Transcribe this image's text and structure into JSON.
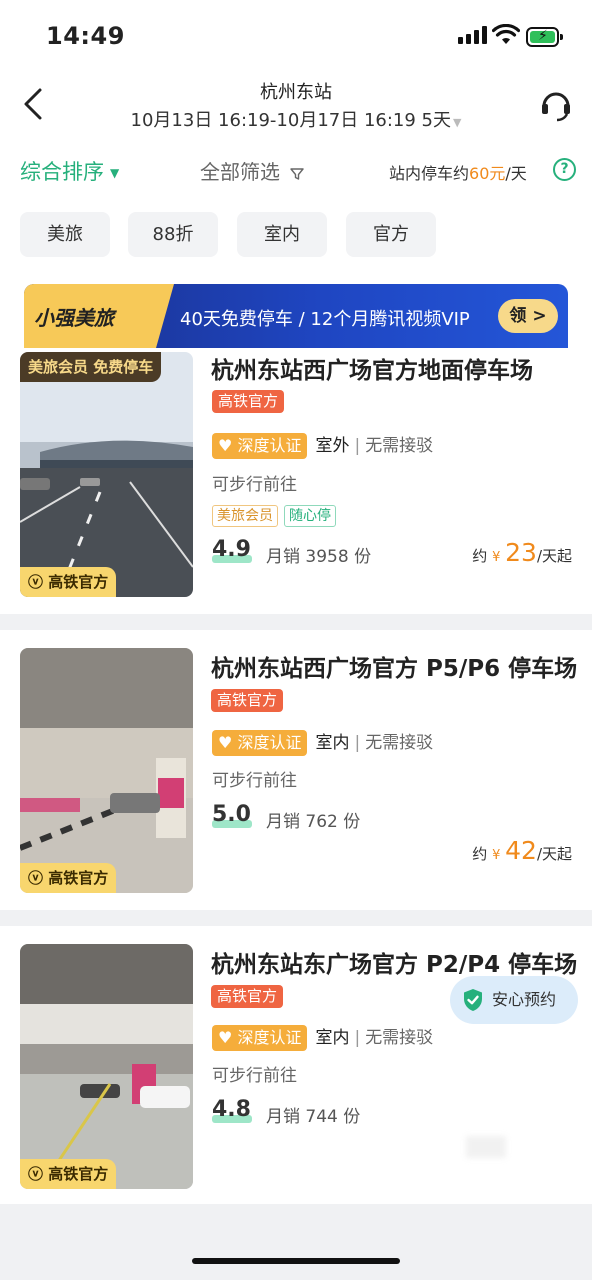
{
  "status_bar": {
    "time": "14:49"
  },
  "header": {
    "title": "杭州东站",
    "subtitle": "10月13日 16:19-10月17日 16:19 5天"
  },
  "filters": {
    "sort_label": "综合排序",
    "all_filter_label": "全部筛选",
    "station_price_prefix": "站内停车约",
    "station_price_value": "60元",
    "station_price_suffix": "/天",
    "help": "?"
  },
  "chips": [
    "美旅",
    "88折",
    "室内",
    "官方"
  ],
  "banner": {
    "logo": "小强美旅",
    "text": "40天免费停车 / 12个月腾讯视频VIP",
    "button": "领 >"
  },
  "cards": [
    {
      "name": "杭州东站西广场官方地面停车场",
      "badge": "高铁官方",
      "top_tag": "美旅会员 免费停车",
      "bottom_tag": "高铁官方",
      "auth": "深度认证",
      "location_type": "室外",
      "shuttle": "无需接驳",
      "walk": "可步行前往",
      "tags": [
        "美旅会员",
        "随心停"
      ],
      "rating": "4.9",
      "sales": "月销 3958 份",
      "price_prefix": "约",
      "price_currency": "¥",
      "price": "23",
      "price_suffix": "/天起"
    },
    {
      "name": "杭州东站西广场官方 P5/P6 停车场",
      "badge": "高铁官方",
      "bottom_tag": "高铁官方",
      "auth": "深度认证",
      "location_type": "室内",
      "shuttle": "无需接驳",
      "walk": "可步行前往",
      "rating": "5.0",
      "sales": "月销 762 份",
      "price_prefix": "约",
      "price_currency": "¥",
      "price": "42",
      "price_suffix": "/天起"
    },
    {
      "name": "杭州东站东广场官方 P2/P4 停车场",
      "badge": "高铁官方",
      "bottom_tag": "高铁官方",
      "auth": "深度认证",
      "location_type": "室内",
      "shuttle": "无需接驳",
      "walk": "可步行前往",
      "rating": "4.8",
      "sales": "月销 744 份"
    }
  ],
  "floating": {
    "safe_booking": "安心预约"
  },
  "colors": {
    "accent_green": "#26b07c",
    "price_orange": "#f08a1c",
    "official_red": "#ef6542",
    "auth_gold": "#f5ad3b"
  }
}
